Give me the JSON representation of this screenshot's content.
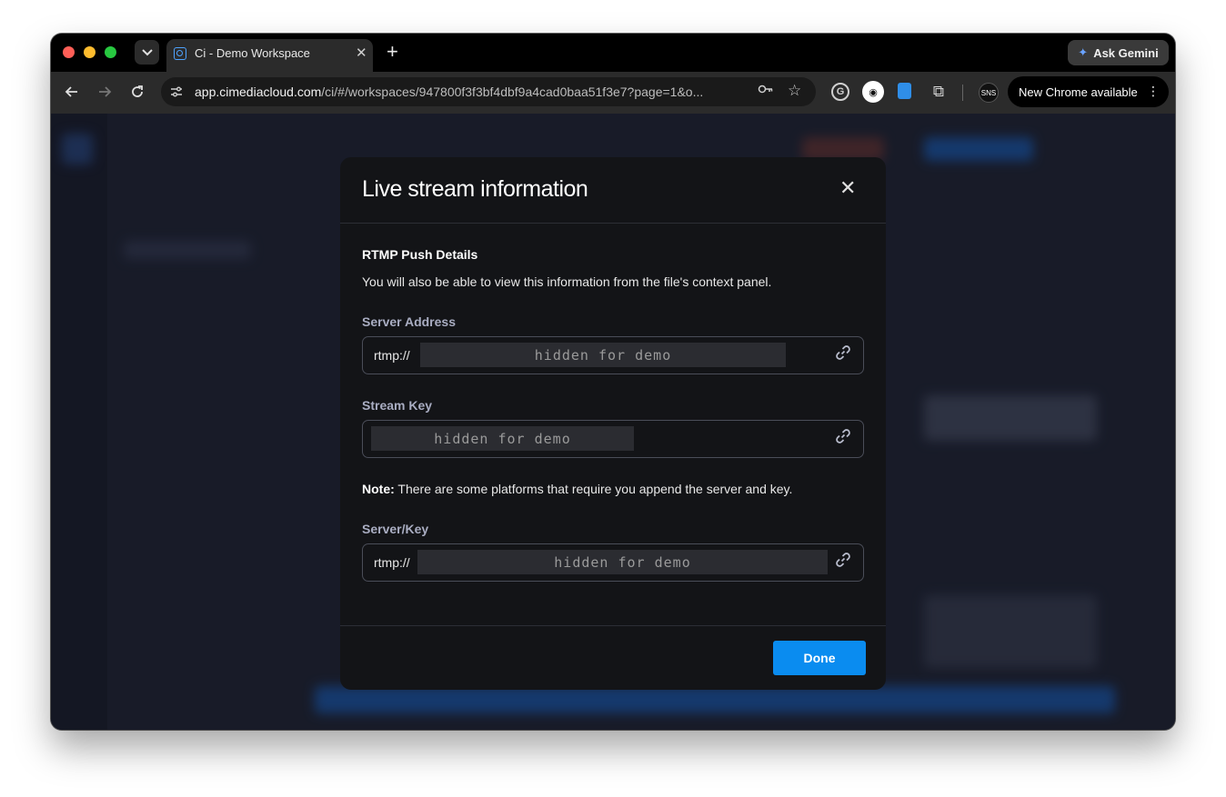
{
  "browser": {
    "tab_title": "Ci - Demo Workspace",
    "tab_close": "✕",
    "new_tab": "+",
    "ask_gemini": "Ask Gemini",
    "url_host": "app.cimediacloud.com",
    "url_path": "/ci/#/workspaces/947800f3f3bf4dbf9a4cad0baa51f3e7?page=1&o...",
    "new_chrome": "New Chrome available",
    "profile_badge": "SNS"
  },
  "icons": {
    "back": "arrow-left-icon",
    "forward": "arrow-right-icon",
    "reload": "reload-icon",
    "star": "star-icon",
    "key": "key-icon",
    "copy": "link-icon",
    "close": "close-icon"
  },
  "modal": {
    "title": "Live stream information",
    "close": "✕",
    "section_title": "RTMP Push Details",
    "section_desc": "You will also be able to view this information from the file's context panel.",
    "server_address": {
      "label": "Server Address",
      "prefix": "rtmp://",
      "masked": "hidden for demo"
    },
    "stream_key": {
      "label": "Stream Key",
      "masked": "hidden for demo"
    },
    "note_bold": "Note:",
    "note_text": " There are some platforms that require you append the server and key.",
    "server_key": {
      "label": "Server/Key",
      "prefix": "rtmp://",
      "masked": "hidden for demo"
    },
    "done": "Done"
  },
  "colors": {
    "accent": "#0a8cf0",
    "modal_bg": "#131417",
    "label": "#a9adc2"
  }
}
